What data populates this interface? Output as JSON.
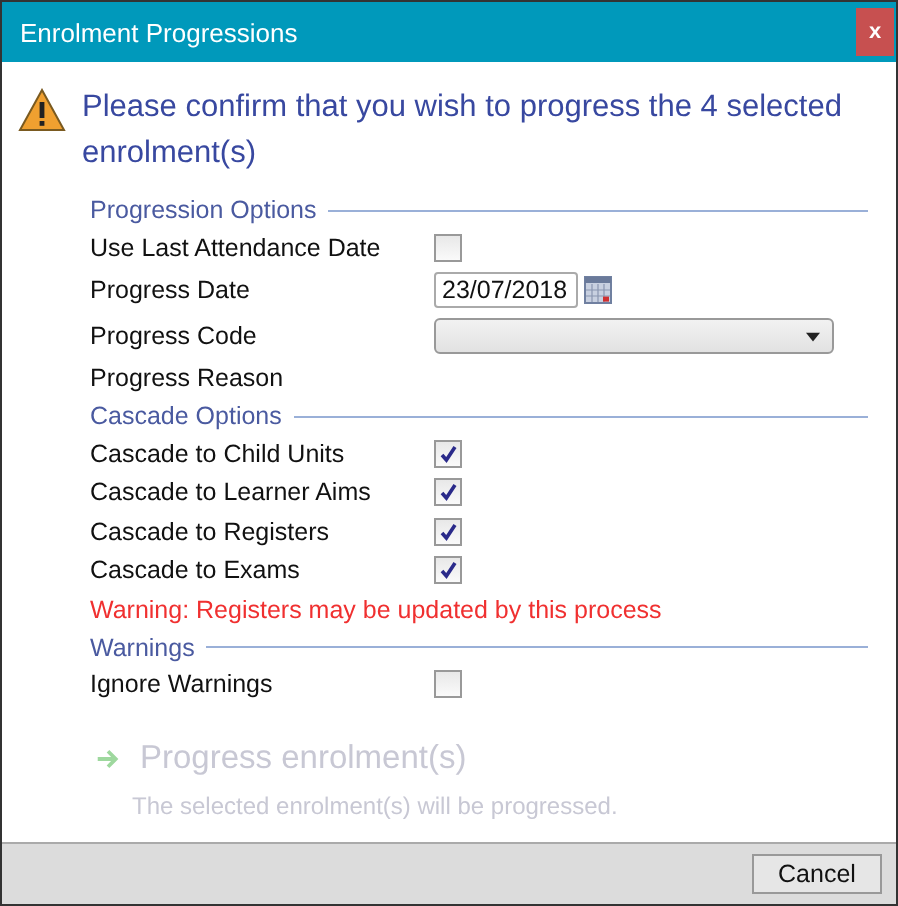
{
  "window": {
    "title": "Enrolment Progressions",
    "close": "x"
  },
  "heading": "Please confirm that you wish to progress the 4 selected enrolment(s)",
  "sections": [
    {
      "title": "Progression Options",
      "fields": [
        {
          "kind": "checkbox",
          "label": "Use Last Attendance Date",
          "checked": false
        },
        {
          "kind": "date",
          "label": "Progress Date",
          "value": "23/07/2018"
        },
        {
          "kind": "dropdown",
          "label": "Progress Code"
        },
        {
          "kind": "text",
          "label": "Progress Reason"
        }
      ]
    },
    {
      "title": "Cascade Options",
      "fields": [
        {
          "kind": "checkbox",
          "label": "Cascade to Child Units",
          "checked": true
        },
        {
          "kind": "checkbox",
          "label": "Cascade to Learner Aims",
          "checked": true
        },
        {
          "kind": "checkbox",
          "label": "Cascade to Registers",
          "checked": true
        },
        {
          "kind": "checkbox",
          "label": "Cascade to Exams",
          "checked": true
        },
        {
          "kind": "warning",
          "label": "Warning: Registers may be updated by this process"
        }
      ]
    },
    {
      "title": "Warnings",
      "fields": [
        {
          "kind": "checkbox",
          "label": "Ignore Warnings",
          "checked": false
        }
      ]
    }
  ],
  "action": {
    "label": "Progress enrolment(s)",
    "description": "The selected enrolment(s) will be progressed.",
    "disabled": true
  },
  "buttons": [
    "Cancel"
  ]
}
